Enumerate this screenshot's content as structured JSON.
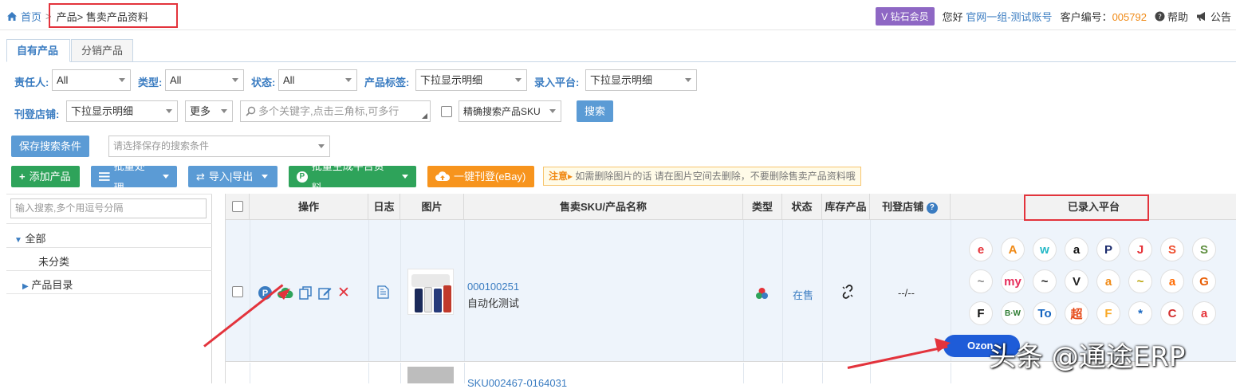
{
  "breadcrumb": {
    "home": "首页",
    "sep": ">",
    "current": "产品> 售卖产品资料"
  },
  "header": {
    "vip": "钻石会员",
    "greeting": "您好",
    "account": "官网一组-测试账号",
    "customer_label": "客户编号：",
    "customer_id": "005792",
    "help": "帮助",
    "notice": "公告"
  },
  "tabs": [
    "自有产品",
    "分销产品"
  ],
  "filters": {
    "owner_label": "责任人:",
    "owner_value": "All",
    "type_label": "类型:",
    "type_value": "All",
    "status_label": "状态:",
    "status_value": "All",
    "tag_label": "产品标签:",
    "tag_value": "下拉显示明细",
    "platform_label": "录入平台:",
    "platform_value": "下拉显示明细",
    "store_label": "刊登店铺:",
    "store_value": "下拉显示明细",
    "more_value": "更多",
    "keyword_placeholder": "多个关键字,点击三角标,可多行",
    "exact_label": "精确搜索产品SKU",
    "search_button": "搜索",
    "save_search": "保存搜索条件",
    "saved_placeholder": "请选择保存的搜索条件"
  },
  "actions": {
    "add": "添加产品",
    "batch": "批量处理",
    "import_export": "导入|导出",
    "generate": "批量生成平台资料",
    "publish": "一键刊登(eBay)",
    "note_title": "注意",
    "note_text": "如需删除图片的话 请在图片空间去删除，不要删除售卖产品资料哦"
  },
  "tree": {
    "search_placeholder": "输入搜索,多个用逗号分隔",
    "all": "全部",
    "uncategorized": "未分类",
    "catalog": "产品目录"
  },
  "table": {
    "headers": [
      "操作",
      "日志",
      "图片",
      "售卖SKU/产品名称",
      "类型",
      "状态",
      "库存产品",
      "刊登店铺",
      "已录入平台"
    ],
    "rows": [
      {
        "sku": "000100251",
        "name": "自动化测试",
        "status": "在售",
        "store": "--/--"
      },
      {
        "sku": "SKU002467-0164031"
      }
    ]
  },
  "platforms": [
    "e",
    "A",
    "w",
    "a",
    "P",
    "J",
    "S",
    "S",
    "~",
    "my",
    "~",
    "V",
    "a",
    "~",
    "a",
    "G",
    "F",
    "B·W",
    "To",
    "超",
    "F",
    "*",
    "C",
    "a"
  ],
  "platform_colors": [
    "#e53238",
    "#f08a16",
    "#23b8c6",
    "#111111",
    "#1a2a6c",
    "#e53238",
    "#ee4d2d",
    "#5e8e3e",
    "#888888",
    "#e62e5c",
    "#222222",
    "#222222",
    "#f08a16",
    "#b8a100",
    "#ff6a00",
    "#e85d04",
    "#111111",
    "#2e7d32",
    "#1565c0",
    "#e64a19",
    "#f9a825",
    "#1565c0",
    "#d32f2f",
    "#e53238"
  ],
  "ozon": "Ozon",
  "watermark": "头条 @通途ERP"
}
